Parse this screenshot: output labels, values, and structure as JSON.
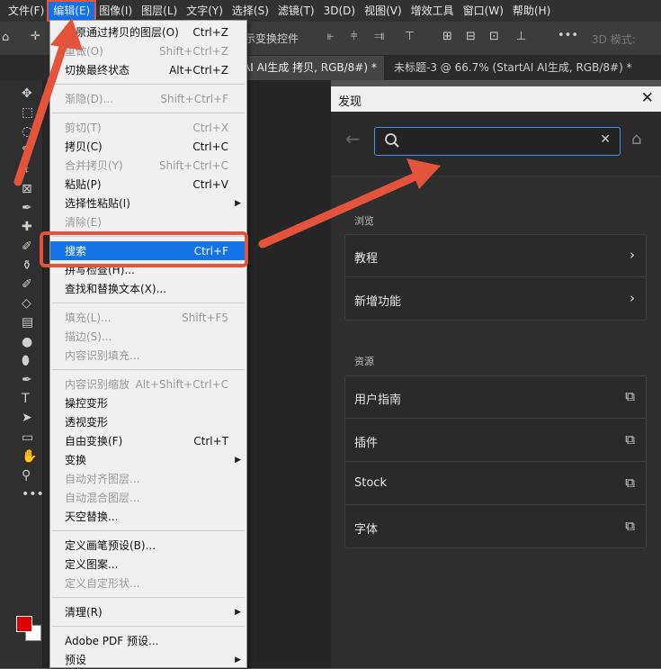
{
  "menubar": {
    "items": [
      "文件(F)",
      "编辑(E)",
      "图像(I)",
      "图层(L)",
      "文字(Y)",
      "选择(S)",
      "滤镜(T)",
      "3D(D)",
      "视图(V)",
      "增效工具",
      "窗口(W)",
      "帮助(H)"
    ],
    "active_index": 1
  },
  "optionsbar": {
    "transform_label": "示变换控件",
    "mode_label": "3D 模式:",
    "more": "•••"
  },
  "tabs": [
    {
      "label": "AI AI生成 拷贝, RGB/8#) *",
      "active": true
    },
    {
      "label": "未标题-3 @ 66.7% (StartAI AI生成, RGB/8#) *",
      "active": false
    }
  ],
  "edit_menu": {
    "items": [
      {
        "label": "还原通过拷贝的图层(O)",
        "shortcut": "Ctrl+Z",
        "disabled": false
      },
      {
        "label": "重做(O)",
        "shortcut": "Shift+Ctrl+Z",
        "disabled": true
      },
      {
        "label": "切换最终状态",
        "shortcut": "Alt+Ctrl+Z",
        "disabled": false
      },
      {
        "sep": true
      },
      {
        "label": "渐隐(D)...",
        "shortcut": "Shift+Ctrl+F",
        "disabled": true
      },
      {
        "sep": true
      },
      {
        "label": "剪切(T)",
        "shortcut": "Ctrl+X",
        "disabled": true
      },
      {
        "label": "拷贝(C)",
        "shortcut": "Ctrl+C",
        "disabled": false
      },
      {
        "label": "合并拷贝(Y)",
        "shortcut": "Shift+Ctrl+C",
        "disabled": true
      },
      {
        "label": "粘贴(P)",
        "shortcut": "Ctrl+V",
        "disabled": false
      },
      {
        "label": "选择性粘贴(I)",
        "shortcut": "",
        "disabled": false,
        "submenu": true
      },
      {
        "label": "清除(E)",
        "shortcut": "",
        "disabled": true
      },
      {
        "sep": true
      },
      {
        "label": "搜索",
        "shortcut": "Ctrl+F",
        "disabled": false,
        "highlight": true
      },
      {
        "label": "拼写检查(H)...",
        "shortcut": "",
        "disabled": false
      },
      {
        "label": "查找和替换文本(X)...",
        "shortcut": "",
        "disabled": false
      },
      {
        "sep": true
      },
      {
        "label": "填充(L)...",
        "shortcut": "Shift+F5",
        "disabled": true
      },
      {
        "label": "描边(S)...",
        "shortcut": "",
        "disabled": true
      },
      {
        "label": "内容识别填充...",
        "shortcut": "",
        "disabled": true
      },
      {
        "sep": true
      },
      {
        "label": "内容识别缩放",
        "shortcut": "Alt+Shift+Ctrl+C",
        "disabled": true
      },
      {
        "label": "操控变形",
        "shortcut": "",
        "disabled": false
      },
      {
        "label": "透视变形",
        "shortcut": "",
        "disabled": false
      },
      {
        "label": "自由变换(F)",
        "shortcut": "Ctrl+T",
        "disabled": false
      },
      {
        "label": "变换",
        "shortcut": "",
        "disabled": false,
        "submenu": true
      },
      {
        "label": "自动对齐图层...",
        "shortcut": "",
        "disabled": true
      },
      {
        "label": "自动混合图层...",
        "shortcut": "",
        "disabled": true
      },
      {
        "label": "天空替换...",
        "shortcut": "",
        "disabled": false
      },
      {
        "sep": true
      },
      {
        "label": "定义画笔预设(B)...",
        "shortcut": "",
        "disabled": false
      },
      {
        "label": "定义图案...",
        "shortcut": "",
        "disabled": false
      },
      {
        "label": "定义自定形状...",
        "shortcut": "",
        "disabled": true
      },
      {
        "sep": true
      },
      {
        "label": "清理(R)",
        "shortcut": "",
        "disabled": false,
        "submenu": true
      },
      {
        "sep": true
      },
      {
        "label": "Adobe PDF 预设...",
        "shortcut": "",
        "disabled": false
      },
      {
        "label": "预设",
        "shortcut": "",
        "disabled": false,
        "submenu": true
      }
    ]
  },
  "discover": {
    "title": "发现",
    "search_value": "",
    "browse_label": "浏览",
    "browse_items": [
      "教程",
      "新增功能"
    ],
    "resources_label": "资源",
    "resource_items": [
      "用户指南",
      "插件",
      "Stock",
      "字体"
    ]
  },
  "colors": {
    "accent": "#1473e6",
    "annotation": "#e4543c",
    "foreground_swatch": "#e00000",
    "background_swatch": "#ffffff"
  },
  "icons": [
    "move-icon",
    "marquee-icon",
    "lasso-icon",
    "magic-wand-icon",
    "crop-icon",
    "frame-icon",
    "eyedropper-icon",
    "healing-icon",
    "brush-icon",
    "stamp-icon",
    "history-brush-icon",
    "eraser-icon",
    "gradient-icon",
    "blur-icon",
    "dodge-icon",
    "pen-icon",
    "type-icon",
    "path-select-icon",
    "rectangle-icon",
    "hand-icon",
    "zoom-icon",
    "more-icon"
  ]
}
